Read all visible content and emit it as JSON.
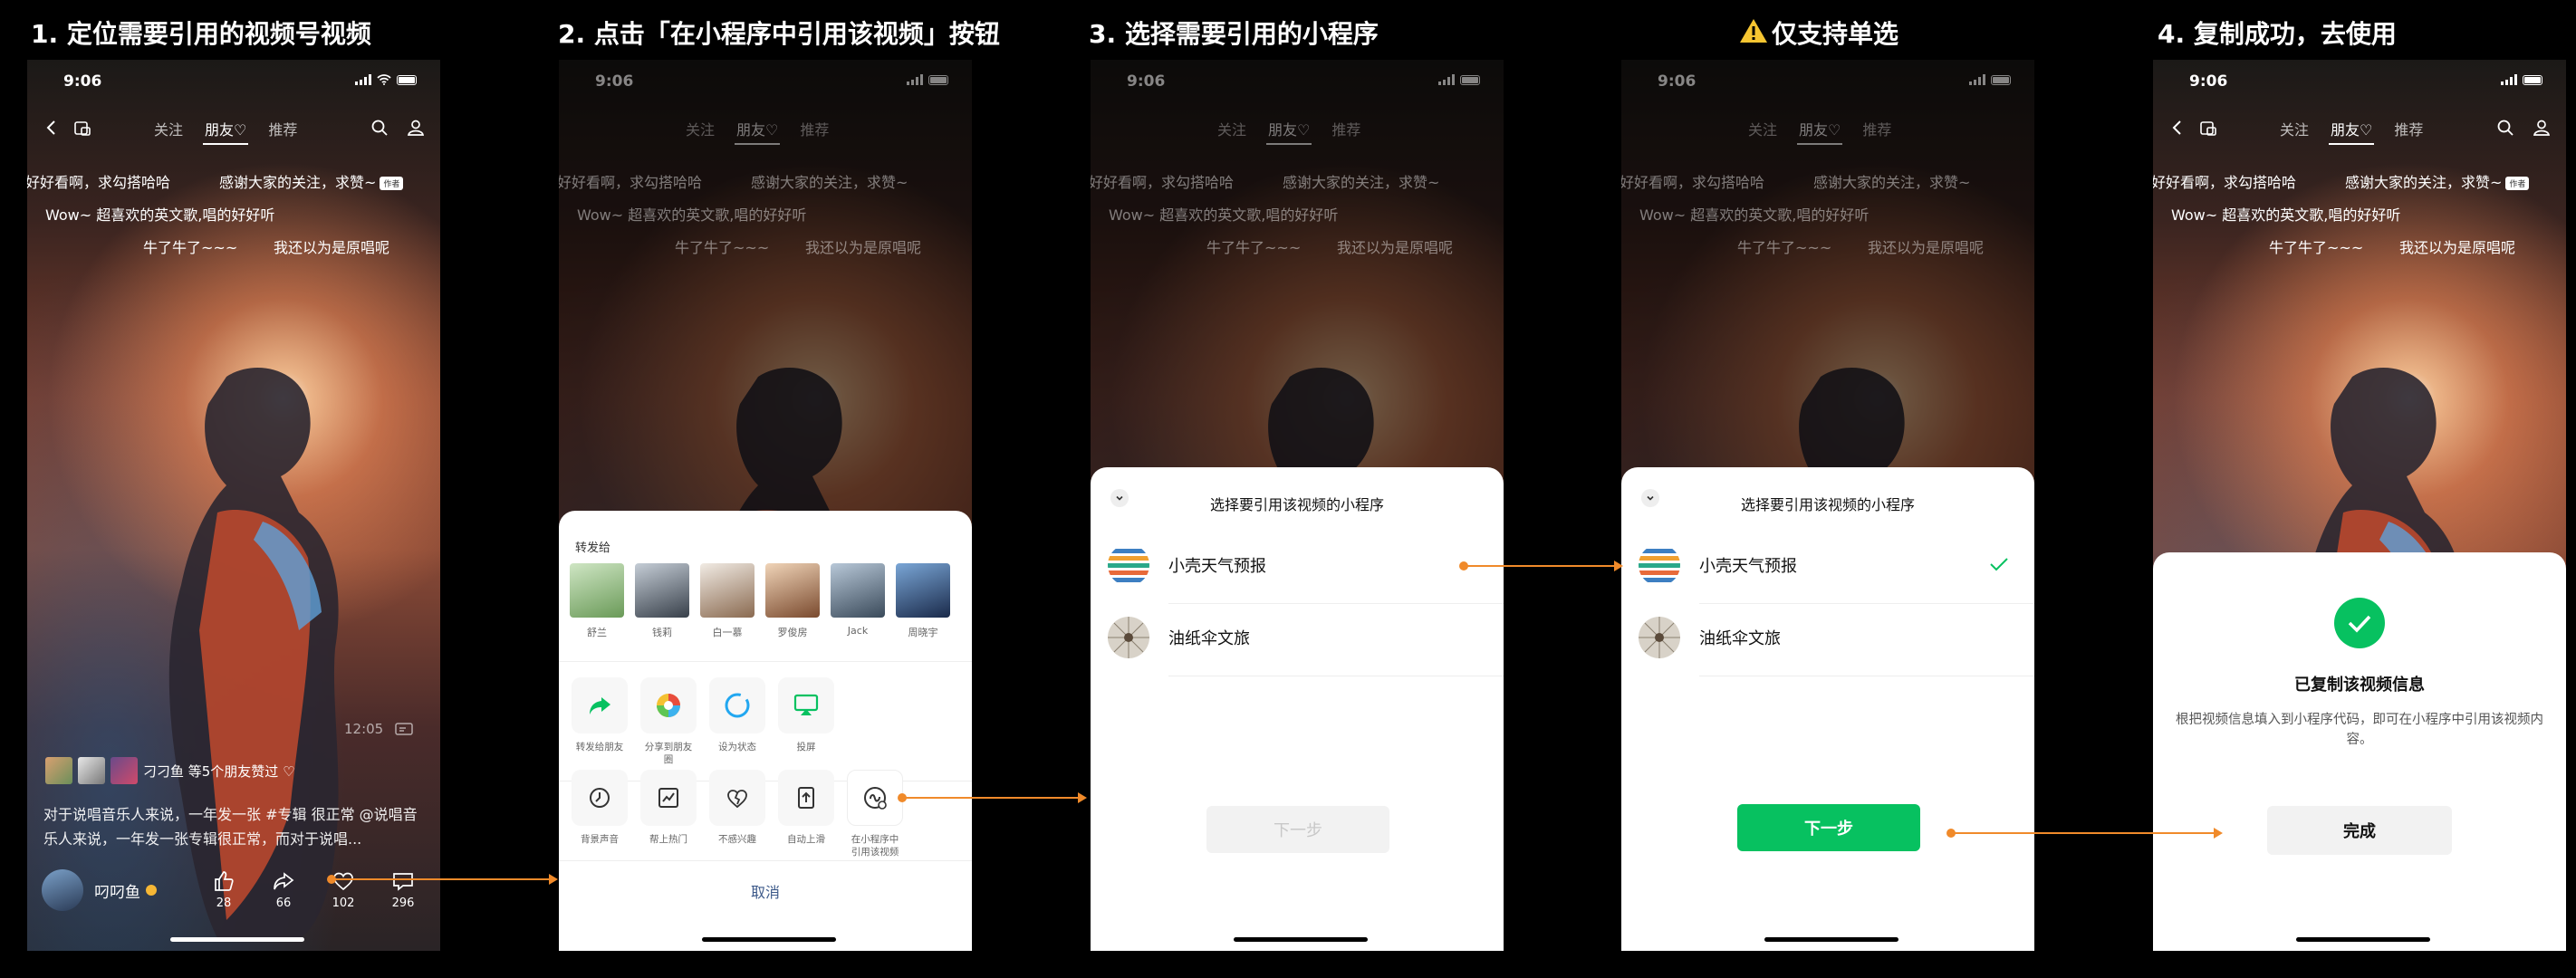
{
  "steps": [
    {
      "title": "1. 定位需要引用的视频号视频"
    },
    {
      "title": "2. 点击「在小程序中引用该视频」按钮"
    },
    {
      "title": "3. 选择需要引用的小程序"
    },
    {
      "title": "仅支持单选"
    },
    {
      "title": "4. 复制成功，去使用"
    }
  ],
  "status": {
    "time": "9:06"
  },
  "nav": {
    "tabs": [
      "关注",
      "朋友♡",
      "推荐"
    ]
  },
  "danmu": [
    "好好看啊，求勾搭哈哈",
    "感谢大家的关注，求赞~",
    "Wow~ 超喜欢的英文歌,唱的好好听",
    "牛了牛了~~~",
    "我还以为是原唱呢"
  ],
  "danmu_tag": "作者",
  "video": {
    "time": "12:05",
    "likes_text": "刁刁鱼 等5个朋友赞过 ♡",
    "caption": "对于说唱音乐人来说，一年发一张 #专辑 很正常 @说唱音乐人来说，一年发一张专辑很正常，而对于说唱...",
    "author": "叼叼鱼",
    "counts": [
      "28",
      "66",
      "102",
      "296"
    ]
  },
  "share": {
    "label": "转发给",
    "contacts": [
      "舒兰",
      "钱莉",
      "白一慕",
      "罗俊房",
      "Jack",
      "周晓宇"
    ],
    "row1": [
      "转发给朋友",
      "分享到朋友圈",
      "设为状态",
      "投屏"
    ],
    "row2": [
      "背景声音",
      "帮上热门",
      "不感兴趣",
      "自动上滑",
      "在小程序中引用该视频"
    ],
    "cancel": "取消"
  },
  "select": {
    "title": "选择要引用该视频的小程序",
    "apps": [
      "小壳天气预报",
      "油纸伞文旅"
    ],
    "next": "下一步"
  },
  "done": {
    "title": "已复制该视频信息",
    "desc": "根把视频信息填入到小程序代码，即可在小程序中引用该视频内容。",
    "button": "完成"
  },
  "colors": {
    "accent": "#07c160",
    "arrow": "#f08a2a",
    "warn": "#f6c531"
  }
}
